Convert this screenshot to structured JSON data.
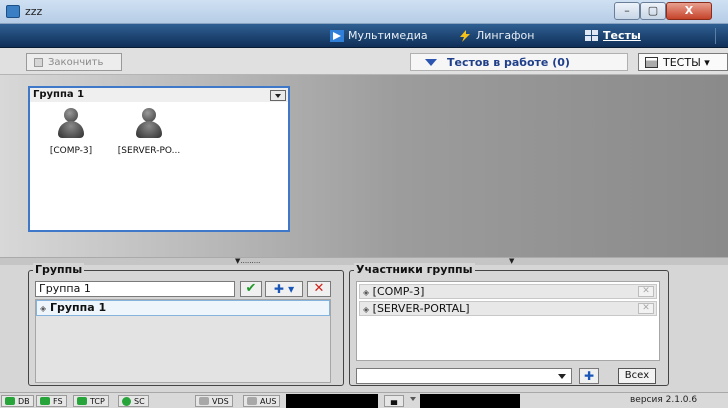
{
  "window": {
    "title": "zzz",
    "min": "–",
    "max": "▢",
    "close": "X"
  },
  "nav": {
    "multimedia": "Мультимедиа",
    "lingafon": "Лингафон",
    "tests": "Тесты"
  },
  "toolbar": {
    "finish_label": "Закончить",
    "tests_running_label": "Тестов в работе (0)",
    "tests_dropdown_label": "ТЕСТЫ ▾"
  },
  "group_card": {
    "title": "Группа 1",
    "members": [
      {
        "label": "[COMP-3]"
      },
      {
        "label": "[SERVER-PO..."
      }
    ]
  },
  "splitter": {
    "left_grip": "▼.........",
    "right_grip": "▼"
  },
  "groups_panel": {
    "legend": "Группы",
    "input_value": "Группа 1",
    "ok_glyph": "✔",
    "add_glyph": "✚ ▾",
    "delete_glyph": "✕",
    "rows": [
      {
        "label": "Группа 1"
      }
    ]
  },
  "members_panel": {
    "legend": "Участники группы",
    "rows": [
      {
        "label": "[COMP-3]"
      },
      {
        "label": "[SERVER-PORTAL]"
      }
    ],
    "add_glyph": "✚",
    "all_label": "Всех"
  },
  "statusbar": {
    "db": "DB",
    "fs": "FS",
    "tcp": "TCP",
    "sc": "SC",
    "vds": "VDS",
    "aus": "AUS",
    "chat_glyph": "▄",
    "version": "версия 2.1.0.6"
  },
  "colors": {
    "nav_band": "#1a3d6b",
    "accent_blue": "#3f78c8",
    "ok_green": "#1e9a2a",
    "delete_red": "#d0231b",
    "led_green": "#27a53a"
  }
}
